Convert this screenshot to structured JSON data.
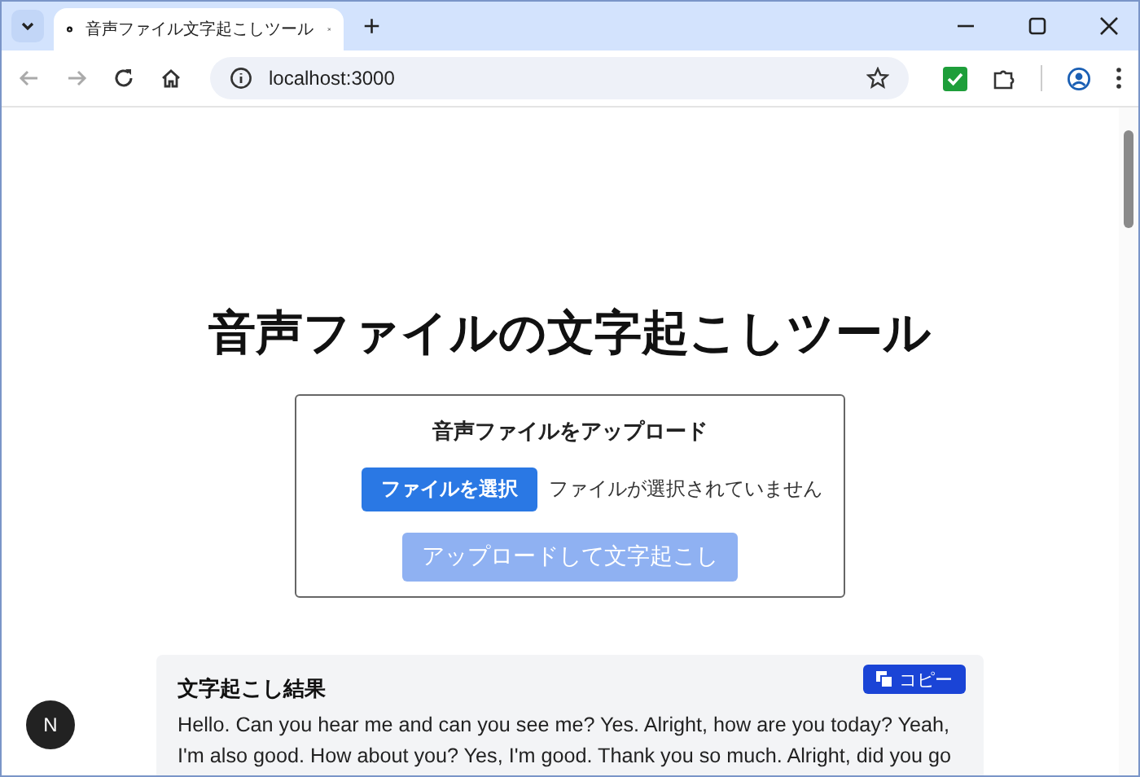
{
  "browser": {
    "tab": {
      "title": "音声ファイル文字起こしツール",
      "selected": true
    },
    "new_tab": "+",
    "address": "localhost:3000"
  },
  "page": {
    "title": "音声ファイルの文字起こしツール",
    "upload": {
      "heading": "音声ファイルをアップロード",
      "choose_button": "ファイルを選択",
      "file_status": "ファイルが選択されていません",
      "submit_button": {
        "label": "アップロードして文字起こし",
        "disabled": true
      }
    },
    "result": {
      "heading": "文字起こし結果",
      "copy_button": "コピー",
      "text": "Hello. Can you hear me and can you see me? Yes. Alright, how are you today? Yeah, I'm also good. How about you? Yes, I'm good. Thank you so much. Alright, did you go"
    },
    "dev_indicator": "N"
  }
}
